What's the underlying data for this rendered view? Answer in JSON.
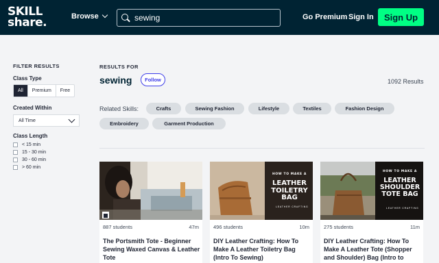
{
  "header": {
    "logo_line1": "SKILL",
    "logo_line2": "share.",
    "browse_label": "Browse",
    "search_value": "sewing",
    "go_premium": "Go Premium",
    "sign_in": "Sign In",
    "sign_up": "Sign Up"
  },
  "sidebar": {
    "title": "FILTER RESULTS",
    "class_type": {
      "label": "Class Type",
      "options": [
        "All",
        "Premium",
        "Free"
      ],
      "selected": "All"
    },
    "created_within": {
      "label": "Created Within",
      "selected": "All Time"
    },
    "class_length": {
      "label": "Class Length",
      "options": [
        "< 15 min",
        "15 - 30 min",
        "30 - 60 min",
        "> 60 min"
      ]
    }
  },
  "main": {
    "results_for": "RESULTS FOR",
    "query": "sewing",
    "follow": "Follow",
    "count": "1092 Results",
    "related_label": "Related Skills:",
    "related_skills": [
      "Crafts",
      "Sewing Fashion",
      "Lifestyle",
      "Textiles",
      "Fashion Design",
      "Embroidery",
      "Garment Production"
    ]
  },
  "cards": [
    {
      "students": "887 students",
      "duration": "47m",
      "title": "The Portsmith Tote - Beginner Sewing Waxed Canvas & Leather Tote"
    },
    {
      "students": "496 students",
      "duration": "10m",
      "title": "DIY Leather Crafting: How To Make A Leather Toiletry Bag (Intro To Sewing)",
      "thumb_top": "HOW TO MAKE A",
      "thumb_main": "LEATHER TOILETRY BAG",
      "thumb_sub": "LEATHER CRAFTING"
    },
    {
      "students": "275 students",
      "duration": "11m",
      "title": "DIY Leather Crafting: How To Make A Leather Tote (Shopper and Shoulder) Bag (Intro to",
      "thumb_top": "HOW TO MAKE A",
      "thumb_main": "LEATHER SHOULDER TOTE BAG",
      "thumb_sub": "LEATHER CRAFTING"
    }
  ],
  "colors": {
    "header_bg": "#002333",
    "accent_green": "#00ff84",
    "follow_blue": "#3c3ce8",
    "chip_bg": "#dadee2"
  }
}
